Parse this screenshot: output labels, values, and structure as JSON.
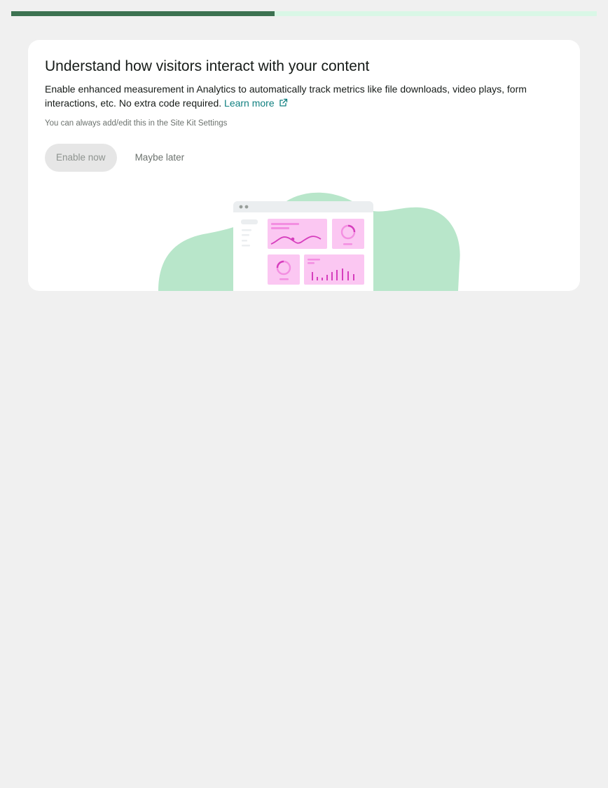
{
  "progress": {
    "fraction": 0.45,
    "fill_color": "#3c7251",
    "track_color": "#d9f7e6"
  },
  "banner": {
    "title": "Understand how visitors interact with your content",
    "description": "Enable enhanced measurement in Analytics to automatically track metrics like file downloads, video plays, form interactions, etc. No extra code required.",
    "learn_more_label": "Learn more",
    "learn_more_icon": "external-link-icon",
    "note": "You can always add/edit this in the Site Kit Settings",
    "enable_label": "Enable now",
    "later_label": "Maybe later"
  },
  "colors": {
    "link": "#108080",
    "blob": "#b8e6ca",
    "chart_accent": "#d63ebd",
    "chart_bg": "#fbc7f2"
  }
}
